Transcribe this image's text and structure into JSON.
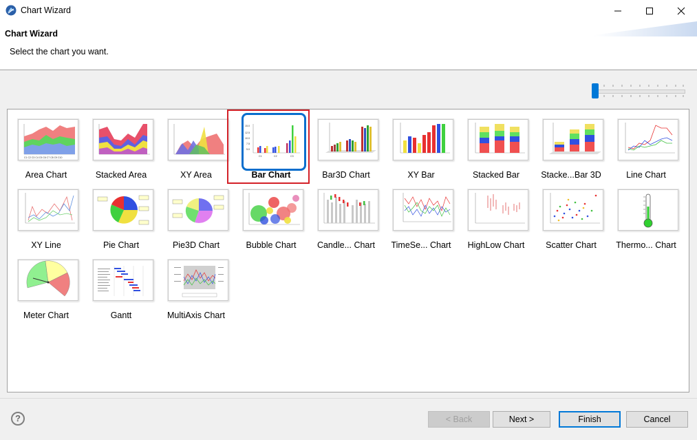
{
  "window": {
    "title": "Chart Wizard",
    "controls": [
      "minimize",
      "maximize",
      "close"
    ]
  },
  "header": {
    "title": "Chart Wizard",
    "description": "Select the chart you want."
  },
  "charts": [
    {
      "label": "Area Chart",
      "icon": "area-chart-icon"
    },
    {
      "label": "Stacked Area",
      "icon": "stacked-area-icon"
    },
    {
      "label": "XY Area",
      "icon": "xy-area-icon"
    },
    {
      "label": "Bar Chart",
      "icon": "bar-chart-icon",
      "selected": true
    },
    {
      "label": "Bar3D Chart",
      "icon": "bar3d-chart-icon"
    },
    {
      "label": "XY Bar",
      "icon": "xy-bar-icon"
    },
    {
      "label": "Stacked Bar",
      "icon": "stacked-bar-icon"
    },
    {
      "label": "Stacke...Bar 3D",
      "icon": "stacked-bar3d-icon"
    },
    {
      "label": "Line Chart",
      "icon": "line-chart-icon"
    },
    {
      "label": "XY Line",
      "icon": "xy-line-icon"
    },
    {
      "label": "Pie Chart",
      "icon": "pie-chart-icon"
    },
    {
      "label": "Pie3D Chart",
      "icon": "pie3d-chart-icon"
    },
    {
      "label": "Bubble Chart",
      "icon": "bubble-chart-icon"
    },
    {
      "label": "Candle... Chart",
      "icon": "candlestick-chart-icon"
    },
    {
      "label": "TimeSe... Chart",
      "icon": "timeseries-chart-icon"
    },
    {
      "label": "HighLow Chart",
      "icon": "highlow-chart-icon"
    },
    {
      "label": "Scatter Chart",
      "icon": "scatter-chart-icon"
    },
    {
      "label": "Thermo... Chart",
      "icon": "thermometer-chart-icon"
    },
    {
      "label": "Meter Chart",
      "icon": "meter-chart-icon"
    },
    {
      "label": "Gantt",
      "icon": "gantt-chart-icon"
    },
    {
      "label": "MultiAxis Chart",
      "icon": "multiaxis-chart-icon"
    }
  ],
  "buttons": {
    "back": "< Back",
    "next": "Next >",
    "finish": "Finish",
    "cancel": "Cancel"
  },
  "colors": {
    "selection_red": "#d32027",
    "selection_blue": "#0a6ecd",
    "accent": "#0078d7"
  }
}
